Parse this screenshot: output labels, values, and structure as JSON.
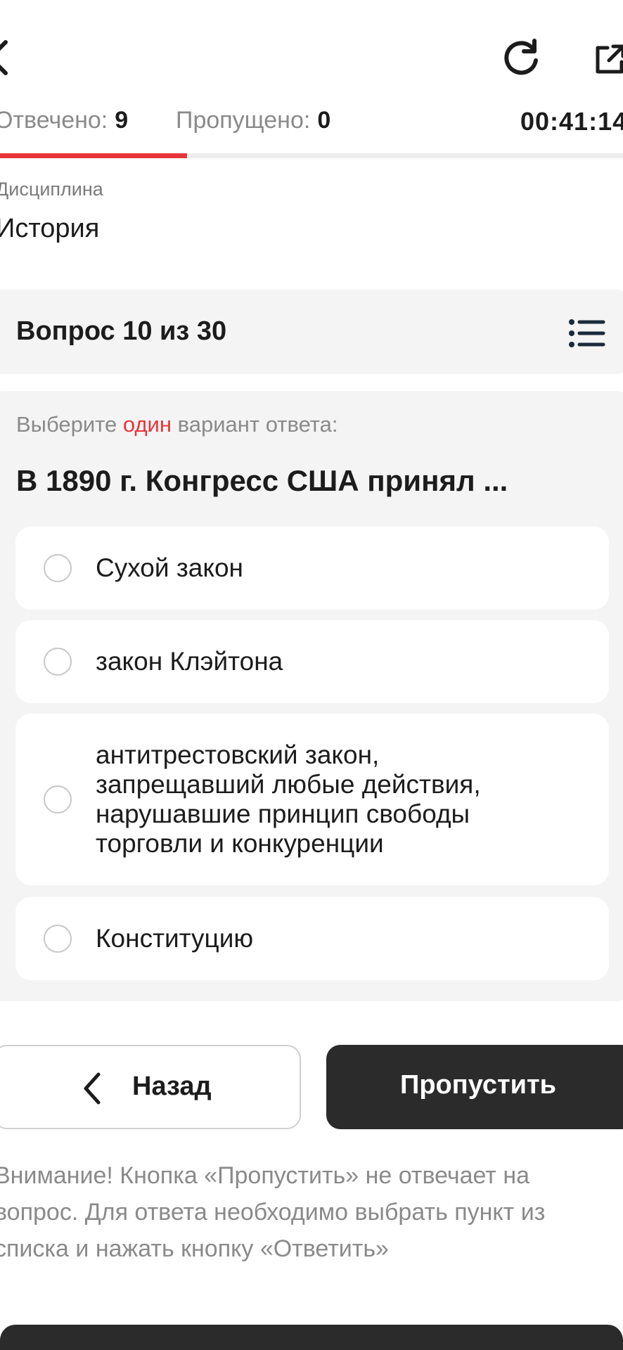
{
  "stats": {
    "answered_label": "Отвечено:",
    "answered_value": "9",
    "skipped_label": "Пропущено:",
    "skipped_value": "0",
    "timer": "00:41:14"
  },
  "progress": {
    "answered": 9,
    "total": 30,
    "fraction": 0.3
  },
  "discipline": {
    "label": "Дисциплина",
    "value": "История"
  },
  "question": {
    "header": "Вопрос 10 из 30",
    "instruction_prefix": "Выберите",
    "instruction_accent": "один",
    "instruction_suffix": "вариант ответа:",
    "text": "В 1890 г. Конгресс США принял ...",
    "options": [
      {
        "label": "Сухой закон"
      },
      {
        "label": "закон Клэйтона"
      },
      {
        "label": "антитрестовский закон, запрещавший любые действия, нарушавшие принцип свободы торговли и конкуренции"
      },
      {
        "label": "Конституцию"
      }
    ]
  },
  "buttons": {
    "back_label": "Назад",
    "skip_label": "Пропустить"
  },
  "notice": "Внимание! Кнопка «Пропустить» не отвечает на вопрос. Для ответа необходимо выбрать пункт из списка и нажать кнопку «Ответить»",
  "colors": {
    "accent": "#e8353b",
    "dark": "#2b2b2b",
    "card": "#f4f4f4",
    "muted": "#8a8a8a"
  },
  "icons": {
    "back": "chevron-left-icon",
    "refresh": "refresh-icon",
    "external": "external-link-icon",
    "list": "list-icon"
  }
}
